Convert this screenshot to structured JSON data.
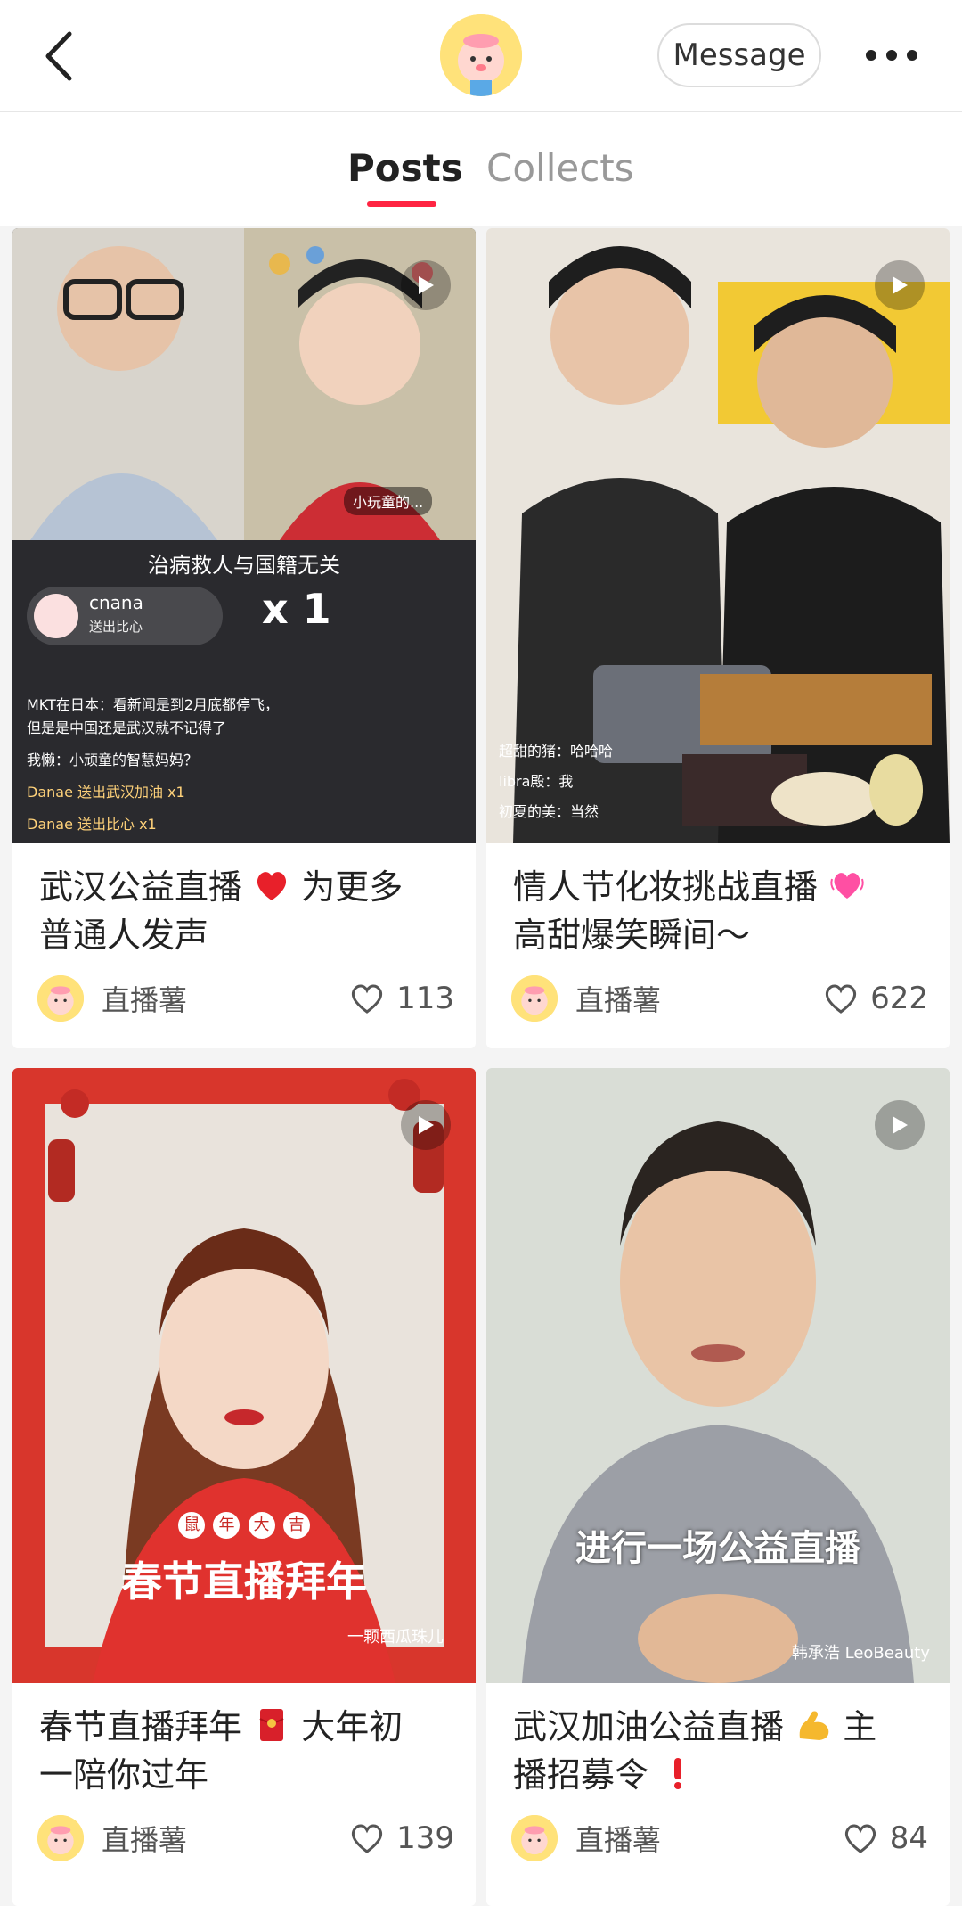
{
  "header": {
    "message_label": "Message"
  },
  "tabs": [
    {
      "label": "Posts",
      "active": true
    },
    {
      "label": "Collects",
      "active": false
    }
  ],
  "posts": [
    {
      "caption": "武汉公益直播 ❤️ 为更多普通人发声",
      "caption_lines": [
        "武汉公益直播",
        "为更多",
        "普通人发声"
      ],
      "author": "直播薯",
      "likes": "113",
      "overlay": {
        "banner": "治病救人与国籍无关",
        "tag": "小玩童的...",
        "user": "cnana",
        "user_sub": "送出比心",
        "count": "x 1",
        "comments": [
          "MKT在日本：看新闻是到2月底都停飞，",
          "但是是中国还是武汉就不记得了",
          "我懒：小顽童的智慧妈妈？",
          "Danae  送出武汉加油 x1",
          "Danae  送出比心 x1"
        ]
      }
    },
    {
      "caption": "情人节化妆挑战直播 💗 高甜爆笑瞬间～",
      "caption_lines": [
        "情人节化妆挑战直播",
        "高甜爆笑瞬间～"
      ],
      "author": "直播薯",
      "likes": "622",
      "overlay": {
        "comments": [
          "超甜的猪：哈哈哈",
          "libra殿：我",
          "初夏的美：当然"
        ]
      }
    },
    {
      "caption": "春节直播拜年 🧧 大年初一陪你过年",
      "caption_lines": [
        "春节直播拜年",
        "大年初",
        "一陪你过年"
      ],
      "author": "直播薯",
      "likes": "139",
      "overlay": {
        "badges": [
          "鼠",
          "年",
          "大",
          "吉"
        ],
        "banner": "春节直播拜年",
        "credit": "一颗西瓜珠儿"
      }
    },
    {
      "caption": "武汉加油公益直播 💪 主播招募令 ❗",
      "caption_lines": [
        "武汉加油公益直播",
        "主",
        "播招募令"
      ],
      "author": "直播薯",
      "likes": "84",
      "overlay": {
        "banner": "进行一场公益直播",
        "credit": "韩承浩 LeoBeauty"
      }
    }
  ],
  "colors": {
    "accent": "#ff2442",
    "like_icon": "#555555"
  }
}
